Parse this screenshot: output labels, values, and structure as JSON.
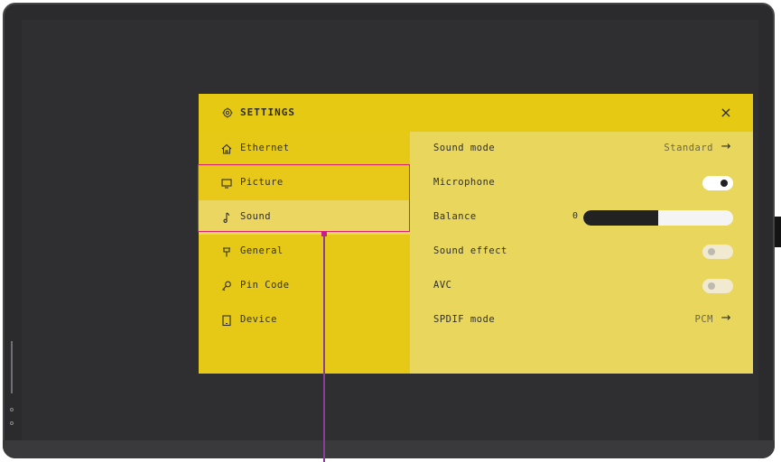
{
  "panel": {
    "title": "SETTINGS",
    "close_label": "×",
    "header_icon": "gear-icon"
  },
  "sidebar": {
    "items": [
      {
        "label": "Ethernet",
        "icon": "home-icon"
      },
      {
        "label": "Picture",
        "icon": "monitor-icon"
      },
      {
        "label": "Sound",
        "icon": "music-note-icon"
      },
      {
        "label": "General",
        "icon": "pin-icon"
      },
      {
        "label": "Pin Code",
        "icon": "key-icon"
      },
      {
        "label": "Device",
        "icon": "tablet-icon"
      }
    ]
  },
  "content": {
    "sound_mode": {
      "label": "Sound mode",
      "value": "Standard",
      "arrow": "→"
    },
    "microphone": {
      "label": "Microphone",
      "state": "on"
    },
    "balance": {
      "label": "Balance",
      "value": "0",
      "fill_fraction": 0.5
    },
    "sound_effect": {
      "label": "Sound effect",
      "state": "off"
    },
    "avc": {
      "label": "AVC",
      "state": "off"
    },
    "spdif_mode": {
      "label": "SPDIF mode",
      "value": "PCM",
      "arrow": "→"
    }
  },
  "colors": {
    "panel_yellow": "#e5c916",
    "content_yellow": "#e8d75c",
    "highlight_border": "#e0206e",
    "pointer_line": "#8a3c9a"
  }
}
